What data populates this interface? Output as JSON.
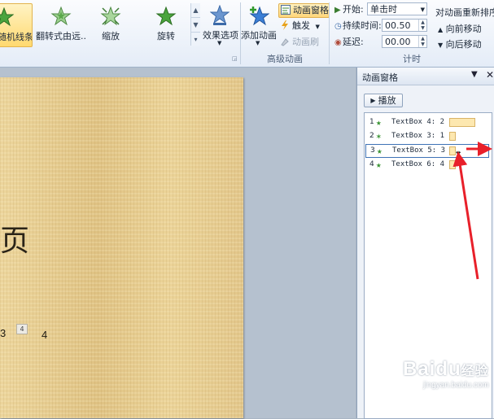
{
  "ribbon": {
    "gallery": [
      {
        "label": "随机线条",
        "selected": true
      },
      {
        "label": "翻转式由远...",
        "selected": false
      },
      {
        "label": "缩放",
        "selected": false
      },
      {
        "label": "旋转",
        "selected": false
      }
    ],
    "effect_options": "效果选项",
    "add_animation": "添加动画",
    "animation_pane": "动画窗格",
    "trigger": "触发",
    "animation_painter": "动画刷",
    "advanced_group": "高级动画",
    "start_label": "开始:",
    "start_value": "单击时",
    "duration_label": "持续时间:",
    "duration_value": "00.50",
    "delay_label": "延迟:",
    "delay_value": "00.00",
    "timing_group": "计时",
    "reorder_title": "对动画重新排序",
    "move_earlier": "向前移动",
    "move_later": "向后移动"
  },
  "slide": {
    "char": "页",
    "numbers": [
      "3",
      "4"
    ],
    "tag": "4"
  },
  "pane": {
    "title": "动画窗格",
    "play": "播放",
    "items": [
      {
        "num": "1",
        "label": "TextBox 4: 2"
      },
      {
        "num": "2",
        "label": "TextBox 3: 1"
      },
      {
        "num": "3",
        "label": "TextBox 5: 3"
      },
      {
        "num": "4",
        "label": "TextBox 6: 4"
      }
    ]
  },
  "watermark": {
    "brand": "Baidu",
    "suffix": "经验",
    "url": "jingyan.baidu.com"
  },
  "colors": {
    "accent": "#3f73b6",
    "arrow": "#e8202a",
    "slide_bg": "#e7cf93"
  }
}
